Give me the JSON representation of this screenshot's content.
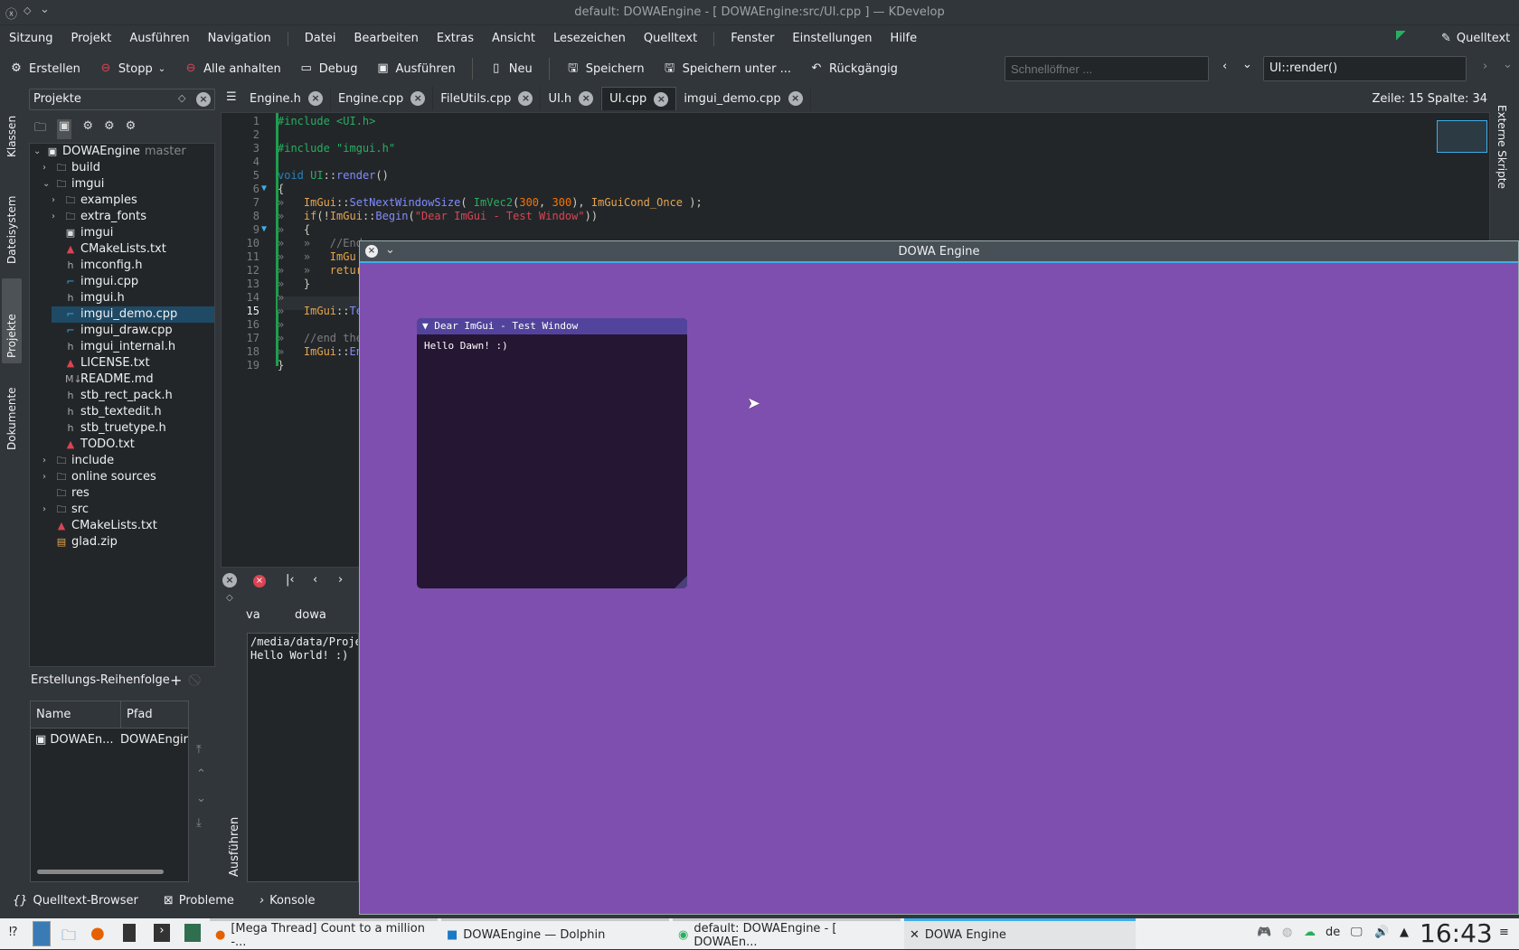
{
  "window": {
    "title": "default: DOWAEngine - [ DOWAEngine:src/UI.cpp ] — KDevelop"
  },
  "menu": {
    "left": [
      "Sitzung",
      "Projekt",
      "Ausführen",
      "Navigation"
    ],
    "mid": [
      "Datei",
      "Bearbeiten",
      "Extras",
      "Ansicht",
      "Lesezeichen",
      "Quelltext"
    ],
    "right": [
      "Fenster",
      "Einstellungen",
      "Hilfe"
    ],
    "quelltext_btn": "Quelltext"
  },
  "toolbar": {
    "items": [
      {
        "label": "Erstellen",
        "icon": "build-icon"
      },
      {
        "label": "Stopp",
        "icon": "stop-icon"
      },
      {
        "label": "Alle anhalten",
        "icon": "stop-all-icon"
      },
      {
        "label": "Debug",
        "icon": "debug-icon"
      },
      {
        "label": "Ausführen",
        "icon": "run-icon"
      },
      {
        "label": "Neu",
        "icon": "new-file-icon"
      },
      {
        "label": "Speichern",
        "icon": "save-icon"
      },
      {
        "label": "Speichern unter ...",
        "icon": "save-as-icon"
      },
      {
        "label": "Rückgängig",
        "icon": "undo-icon"
      }
    ],
    "quick_open_placeholder": "Schnellöffner ...",
    "context": "UI::render()"
  },
  "left_tabs": [
    "Klassen",
    "Dateisystem",
    "Projekte",
    "Dokumente"
  ],
  "right_tabs": [
    "Externe Skripte"
  ],
  "projects": {
    "title": "Projekte",
    "root": "DOWAEngine",
    "branch": "master",
    "rows": [
      {
        "label": "build",
        "type": "folder",
        "indent": 1,
        "arrow": "›"
      },
      {
        "label": "imgui",
        "type": "folder",
        "indent": 1,
        "arrow": "⌄"
      },
      {
        "label": "examples",
        "type": "folder",
        "indent": 2,
        "arrow": "›"
      },
      {
        "label": "extra_fonts",
        "type": "folder",
        "indent": 2,
        "arrow": "›"
      },
      {
        "label": "imgui",
        "type": "project",
        "indent": 2,
        "arrow": ""
      },
      {
        "label": "CMakeLists.txt",
        "type": "cmake",
        "indent": 2,
        "arrow": ""
      },
      {
        "label": "imconfig.h",
        "type": "header",
        "indent": 2,
        "arrow": ""
      },
      {
        "label": "imgui.cpp",
        "type": "cpp",
        "indent": 2,
        "arrow": ""
      },
      {
        "label": "imgui.h",
        "type": "header",
        "indent": 2,
        "arrow": ""
      },
      {
        "label": "imgui_demo.cpp",
        "type": "cpp",
        "indent": 2,
        "arrow": "",
        "selected": true
      },
      {
        "label": "imgui_draw.cpp",
        "type": "cpp",
        "indent": 2,
        "arrow": ""
      },
      {
        "label": "imgui_internal.h",
        "type": "header",
        "indent": 2,
        "arrow": ""
      },
      {
        "label": "LICENSE.txt",
        "type": "cmake",
        "indent": 2,
        "arrow": ""
      },
      {
        "label": "README.md",
        "type": "md",
        "indent": 2,
        "arrow": ""
      },
      {
        "label": "stb_rect_pack.h",
        "type": "header",
        "indent": 2,
        "arrow": ""
      },
      {
        "label": "stb_textedit.h",
        "type": "header",
        "indent": 2,
        "arrow": ""
      },
      {
        "label": "stb_truetype.h",
        "type": "header",
        "indent": 2,
        "arrow": ""
      },
      {
        "label": "TODO.txt",
        "type": "cmake",
        "indent": 2,
        "arrow": ""
      },
      {
        "label": "include",
        "type": "folder",
        "indent": 1,
        "arrow": "›"
      },
      {
        "label": "online sources",
        "type": "folder",
        "indent": 1,
        "arrow": "›"
      },
      {
        "label": "res",
        "type": "folder",
        "indent": 1,
        "arrow": ""
      },
      {
        "label": "src",
        "type": "folder",
        "indent": 1,
        "arrow": "›"
      },
      {
        "label": "CMakeLists.txt",
        "type": "cmake",
        "indent": 1,
        "arrow": ""
      },
      {
        "label": "glad.zip",
        "type": "zip",
        "indent": 1,
        "arrow": ""
      }
    ]
  },
  "build_order": {
    "title": "Erstellungs-Reihenfolge",
    "col_name": "Name",
    "col_path": "Pfad",
    "row_name": "DOWAEn...",
    "row_path": "DOWAEngir"
  },
  "tabs": [
    {
      "label": "Engine.h"
    },
    {
      "label": "Engine.cpp"
    },
    {
      "label": "FileUtils.cpp"
    },
    {
      "label": "UI.h"
    },
    {
      "label": "UI.cpp",
      "active": true
    },
    {
      "label": "imgui_demo.cpp"
    }
  ],
  "status": {
    "cursor": "Zeile: 15 Spalte: 34"
  },
  "console": {
    "tab_partial": "va",
    "tab": "dowa",
    "lines": [
      "/media/data/Proje",
      "Hello World! :)"
    ],
    "vertical_label": "Ausführen"
  },
  "bottom_tabs": [
    "Quelltext-Browser",
    "Probleme",
    "Konsole"
  ],
  "dowa_window": {
    "title": "DOWA Engine",
    "bg": "#7f4fb0"
  },
  "imgui_window": {
    "title": "Dear ImGui - Test Window",
    "text": "Hello Dawn! :)"
  },
  "taskbar": {
    "tasks": [
      "[Mega Thread] Count to a million -...",
      "DOWAEngine — Dolphin",
      "default:  DOWAEngine - [ DOWAEn...",
      "DOWA Engine"
    ],
    "lang": "de",
    "clock": "16:43"
  }
}
